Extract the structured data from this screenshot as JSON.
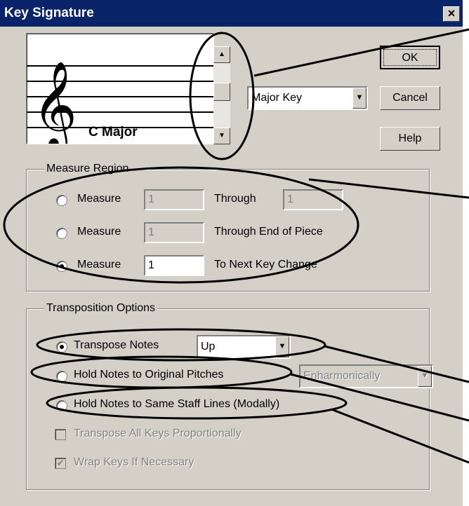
{
  "window": {
    "title": "Key Signature",
    "close_glyph": "×"
  },
  "preview": {
    "key_name": "C Major"
  },
  "key_mode": {
    "selected": "Major Key"
  },
  "buttons": {
    "ok": "OK",
    "cancel": "Cancel",
    "help": "Help"
  },
  "measure_region": {
    "title": "Measure Region",
    "rows": [
      {
        "label": "Measure",
        "from": "1",
        "through_label": "Through",
        "to": "1",
        "selected": false
      },
      {
        "label": "Measure",
        "from": "1",
        "through_label": "Through End of Piece",
        "selected": false
      },
      {
        "label": "Measure",
        "from": "1",
        "through_label": "To Next Key Change",
        "selected": true
      }
    ]
  },
  "transposition": {
    "title": "Transposition Options",
    "transpose_notes": "Transpose Notes",
    "direction": "Up",
    "hold_original": "Hold Notes to Original Pitches",
    "enharmonic": "Enharmonically",
    "hold_staff": "Hold Notes to Same Staff Lines (Modally)",
    "transpose_all": "Transpose All Keys Proportionally",
    "wrap_keys": "Wrap Keys If Necessary"
  },
  "icons": [
    "close-icon",
    "treble-clef-icon",
    "scroll-up-icon",
    "scroll-down-icon",
    "dropdown-arrow-icon",
    "checkmark-icon"
  ]
}
